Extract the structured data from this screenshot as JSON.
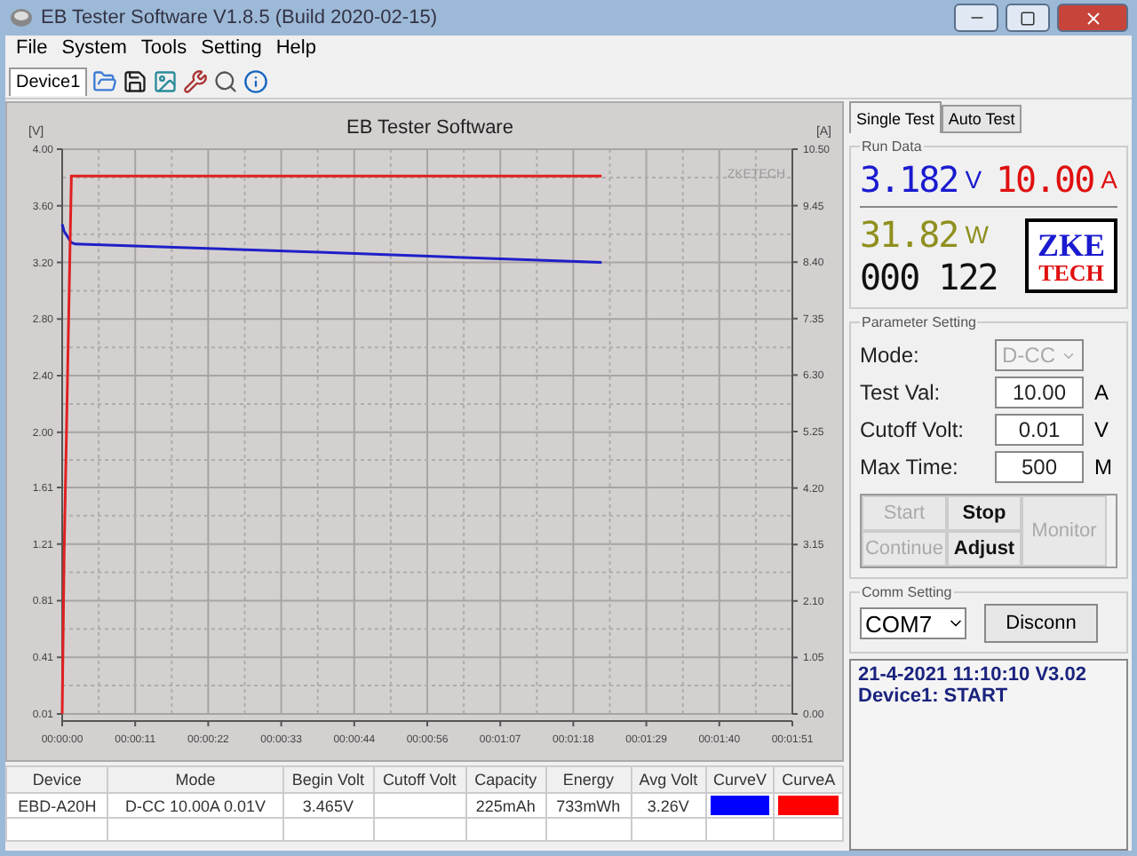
{
  "window": {
    "title": "EB Tester Software V1.8.5 (Build 2020-02-15)"
  },
  "menu": [
    "File",
    "System",
    "Tools",
    "Setting",
    "Help"
  ],
  "toolbar": {
    "device_tab": "Device1"
  },
  "chart": {
    "title": "EB Tester Software",
    "watermark": "ZKETECH",
    "chart_data": {
      "type": "line",
      "grid": true,
      "ylabel": "[V]",
      "y2label": "[A]",
      "xlim": [
        0,
        111
      ],
      "ylim": [
        0.01,
        4.0
      ],
      "y2lim": [
        0,
        10.5
      ],
      "xticks": [
        {
          "value": 0,
          "label": "00:00:00"
        },
        {
          "value": 11.1,
          "label": "00:00:11"
        },
        {
          "value": 22.2,
          "label": "00:00:22"
        },
        {
          "value": 33.3,
          "label": "00:00:33"
        },
        {
          "value": 44.4,
          "label": "00:00:44"
        },
        {
          "value": 55.5,
          "label": "00:00:56"
        },
        {
          "value": 66.6,
          "label": "00:01:07"
        },
        {
          "value": 77.7,
          "label": "00:01:18"
        },
        {
          "value": 88.8,
          "label": "00:01:29"
        },
        {
          "value": 99.9,
          "label": "00:01:40"
        },
        {
          "value": 111,
          "label": "00:01:51"
        }
      ],
      "yticks": [
        {
          "value": 0.01,
          "label": "0.01"
        },
        {
          "value": 0.41,
          "label": "0.41"
        },
        {
          "value": 0.81,
          "label": "0.81"
        },
        {
          "value": 1.21,
          "label": "1.21"
        },
        {
          "value": 1.61,
          "label": "1.61"
        },
        {
          "value": 2.0,
          "label": "2.00"
        },
        {
          "value": 2.4,
          "label": "2.40"
        },
        {
          "value": 2.8,
          "label": "2.80"
        },
        {
          "value": 3.2,
          "label": "3.20"
        },
        {
          "value": 3.6,
          "label": "3.60"
        },
        {
          "value": 4.0,
          "label": "4.00"
        }
      ],
      "y2ticks": [
        {
          "value": 0,
          "label": "0.00"
        },
        {
          "value": 1.05,
          "label": "1.05"
        },
        {
          "value": 2.1,
          "label": "2.10"
        },
        {
          "value": 3.15,
          "label": "3.15"
        },
        {
          "value": 4.2,
          "label": "4.20"
        },
        {
          "value": 5.25,
          "label": "5.25"
        },
        {
          "value": 6.3,
          "label": "6.30"
        },
        {
          "value": 7.35,
          "label": "7.35"
        },
        {
          "value": 8.4,
          "label": "8.40"
        },
        {
          "value": 9.45,
          "label": "9.45"
        },
        {
          "value": 10.5,
          "label": "10.50"
        }
      ],
      "x": [
        0,
        0.3,
        1.4,
        2,
        40,
        82
      ],
      "series": [
        {
          "color": "#1f1fc8",
          "values": [
            3.47,
            3.42,
            3.34,
            3.33,
            3.27,
            3.2
          ]
        },
        {
          "color": "#e02020",
          "axis": "y2",
          "values": [
            0,
            3.0,
            10.0,
            10.0,
            10.0,
            10.0
          ]
        }
      ]
    }
  },
  "tabs": [
    {
      "label": "Single Test",
      "selected": true
    },
    {
      "label": "Auto Test",
      "selected": false
    }
  ],
  "run_data": {
    "title": "Run Data",
    "voltage": "3.182",
    "voltage_unit": "V",
    "current": "10.00",
    "current_unit": "A",
    "power": "31.82",
    "power_unit": "W",
    "time": "000 122",
    "logo_top": "ZKE",
    "logo_bottom": "TECH"
  },
  "parameter_setting": {
    "title": "Parameter Setting",
    "fields": [
      {
        "label": "Mode:",
        "value": "D-CC",
        "kind": "select",
        "disabled": true
      },
      {
        "label": "Test Val:",
        "value": "10.00",
        "unit": "A",
        "kind": "input",
        "disabled": false
      },
      {
        "label": "Cutoff Volt:",
        "value": "0.01",
        "unit": "V",
        "kind": "input",
        "disabled": false
      },
      {
        "label": "Max Time:",
        "value": "500",
        "unit": "M",
        "kind": "input",
        "disabled": false
      }
    ],
    "buttons": [
      {
        "label": "Start",
        "disabled": true
      },
      {
        "label": "Stop",
        "disabled": false
      },
      {
        "label": "Continue",
        "disabled": true
      },
      {
        "label": "Adjust",
        "disabled": false
      }
    ],
    "side_button": {
      "label": "Monitor",
      "disabled": true
    }
  },
  "comm": {
    "title": "Comm Setting",
    "port": "COM7",
    "button": "Disconn"
  },
  "log": [
    "21-4-2021 11:10:10  V3.02",
    "Device1: START"
  ],
  "table": {
    "columns": [
      "Device",
      "Mode",
      "Begin Volt",
      "Cutoff Volt",
      "Capacity",
      "Energy",
      "Avg Volt",
      "CurveV",
      "CurveA"
    ],
    "rows": [
      [
        "EBD-A20H",
        "D-CC 10.00A 0.01V",
        "3.465V",
        "",
        "225mAh",
        "733mWh",
        "3.26V",
        {
          "color": "#0000ff"
        },
        {
          "color": "#ff0000"
        }
      ]
    ]
  }
}
